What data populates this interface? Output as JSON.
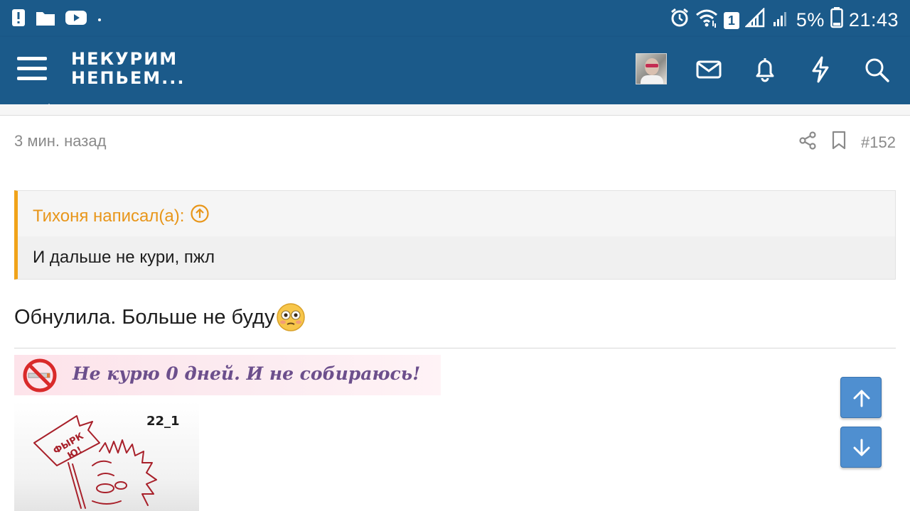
{
  "status_bar": {
    "battery_percent": "5%",
    "time": "21:43",
    "sim_badge": "1",
    "icons": [
      "alert-notification-icon",
      "folder-icon",
      "youtube-icon",
      "dot-icon",
      "alarm-icon",
      "wifi-icon",
      "signal-1-icon",
      "signal-2-icon",
      "battery-icon"
    ]
  },
  "header": {
    "logo_line1": "НЕКУРИМ",
    "logo_line2": "НЕПЬЕМ...",
    "icons": [
      "menu-icon",
      "avatar",
      "mail-icon",
      "bell-icon",
      "lightning-icon",
      "search-icon"
    ],
    "bar_color": "#1b5a8a"
  },
  "post": {
    "time_ago": "3 мин. назад",
    "number": "#152",
    "quote": {
      "author_line": "Тихоня написал(а):",
      "text": "И дальше не кури, пжл",
      "accent_color": "#f0a31a"
    },
    "message": "Обнулила. Больше не буду",
    "emoji": "flushed-face"
  },
  "signature": {
    "banner_text": "Не курю 0 дней. И не собираюсь!",
    "image_label": "22_1"
  },
  "scroll_buttons": {
    "up": "arrow-up-icon",
    "down": "arrow-down-icon",
    "color": "#4f8fd0"
  }
}
